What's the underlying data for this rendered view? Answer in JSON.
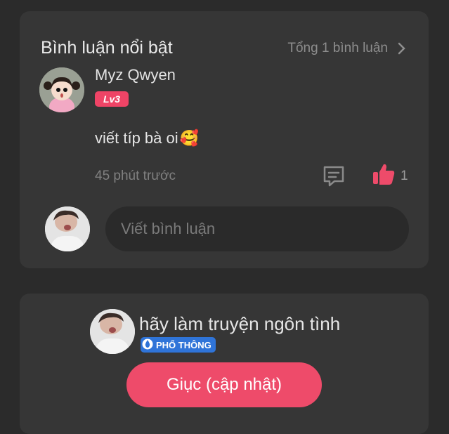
{
  "comments": {
    "title": "Bình luận nổi bật",
    "total_label": "Tổng 1 bình luận",
    "items": [
      {
        "username": "Myz Qwyen",
        "level": "Lv3",
        "text": "viết típ bà oi",
        "emoji": "🥰",
        "time": "45 phút trước",
        "likes": "1"
      }
    ],
    "input_placeholder": "Viết bình luận"
  },
  "author": {
    "message": "hãy làm truyện ngôn tình",
    "tier": "PHỔ THÔNG",
    "urge_button": "Giục (cập nhật)"
  },
  "colors": {
    "background": "#2b2b2b",
    "card": "#363636",
    "accent": "#ee4b6a",
    "tier_blue": "#2f74d8"
  }
}
